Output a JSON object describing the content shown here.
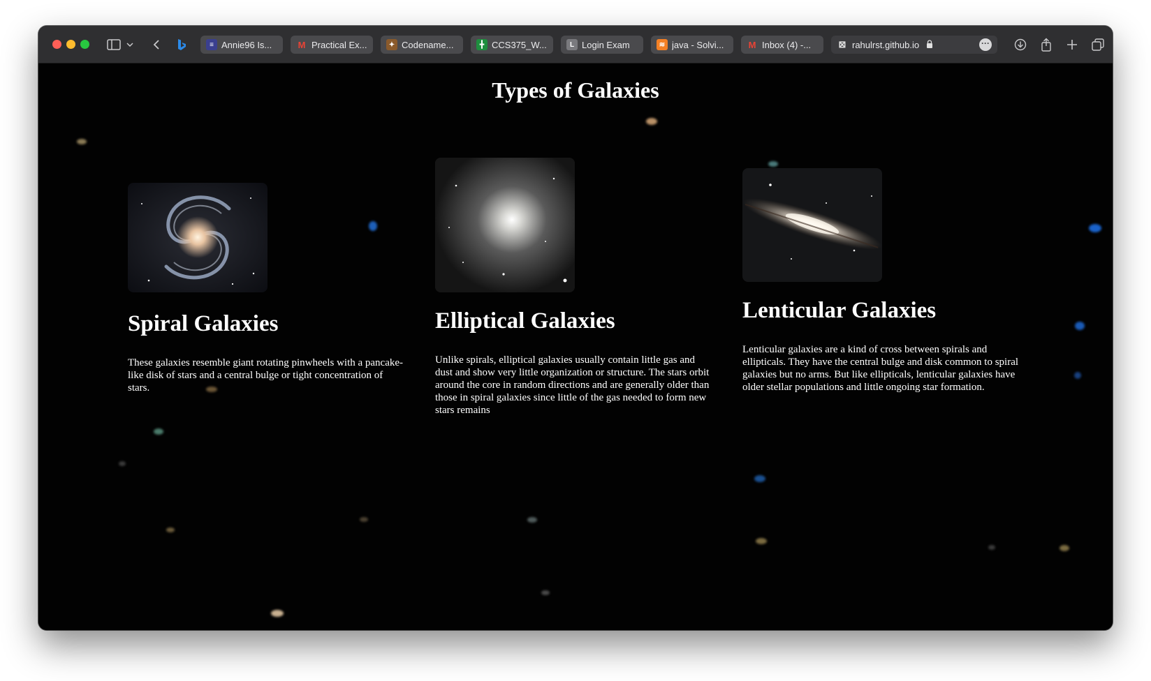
{
  "browser": {
    "tabs": [
      {
        "label": "Annie96 Is...",
        "icon": "document-icon",
        "color": "#3a3f8f"
      },
      {
        "label": "Practical Ex...",
        "icon": "gmail-icon",
        "color": "#ea4335"
      },
      {
        "label": "Codename...",
        "icon": "codename-icon",
        "color": "#8a5a2b"
      },
      {
        "label": "CCS375_W...",
        "icon": "sheets-icon",
        "color": "#1e8e3e"
      },
      {
        "label": "Login Exam",
        "icon": "letter-l-icon",
        "color": "#7a7a7e",
        "letter": "L"
      },
      {
        "label": "java - Solvi...",
        "icon": "stackoverflow-icon",
        "color": "#f48024"
      },
      {
        "label": "Inbox (4) -...",
        "icon": "gmail-icon",
        "color": "#ea4335"
      }
    ],
    "active_tab": {
      "label": "rahulrst.github.io",
      "icon": "close-tab-icon"
    }
  },
  "page": {
    "title": "Types of Galaxies",
    "cards": [
      {
        "title": "Spiral Galaxies",
        "image": "spiral-galaxy-image",
        "text": "These galaxies resemble giant rotating pinwheels with a pancake-like disk of stars and a central bulge or tight concentration of stars."
      },
      {
        "title": "Elliptical Galaxies",
        "image": "elliptical-galaxy-image",
        "text": "Unlike spirals, elliptical galaxies usually contain little gas and dust and show very little organization or structure. The stars orbit around the core in random directions and are generally older than those in spiral galaxies since little of the gas needed to form new stars remains"
      },
      {
        "title": "Lenticular Galaxies",
        "image": "lenticular-galaxy-image",
        "text": "Lenticular galaxies are a kind of cross between spirals and ellipticals. They have the central bulge and disk common to spiral galaxies but no arms. But like ellipticals, lenticular galaxies have older stellar populations and little ongoing star formation."
      }
    ]
  }
}
